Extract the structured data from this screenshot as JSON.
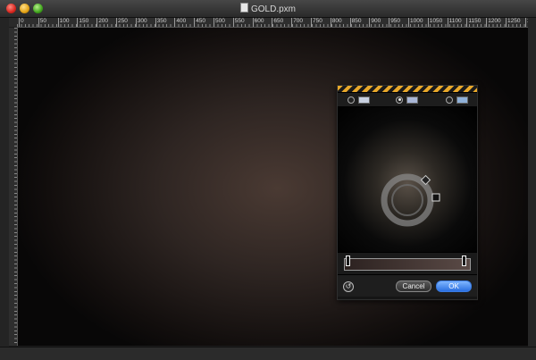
{
  "window": {
    "title": "GOLD.pxm"
  },
  "ruler": {
    "labels": [
      "0",
      "50",
      "100",
      "150",
      "200",
      "250",
      "300",
      "350",
      "400",
      "450",
      "500",
      "550",
      "600",
      "650",
      "700",
      "750",
      "800",
      "850",
      "900",
      "950",
      "1000",
      "1050",
      "1100",
      "1150",
      "1200",
      "1250",
      "1300",
      "1350",
      "1400"
    ]
  },
  "panel": {
    "modes": [
      {
        "name": "mode-1",
        "selected": false,
        "swatch_color": "#c8d0e0"
      },
      {
        "name": "mode-2",
        "selected": true,
        "swatch_color": "#a9b6d6"
      },
      {
        "name": "mode-3",
        "selected": false,
        "swatch_color": "#8fb0d8"
      }
    ],
    "cancel_label": "Cancel",
    "ok_label": "OK",
    "undo_icon": "rotate-left-icon"
  },
  "colors": {
    "hazard_stripe": "#e9a82a",
    "ok_button": "#2a6fe0"
  }
}
